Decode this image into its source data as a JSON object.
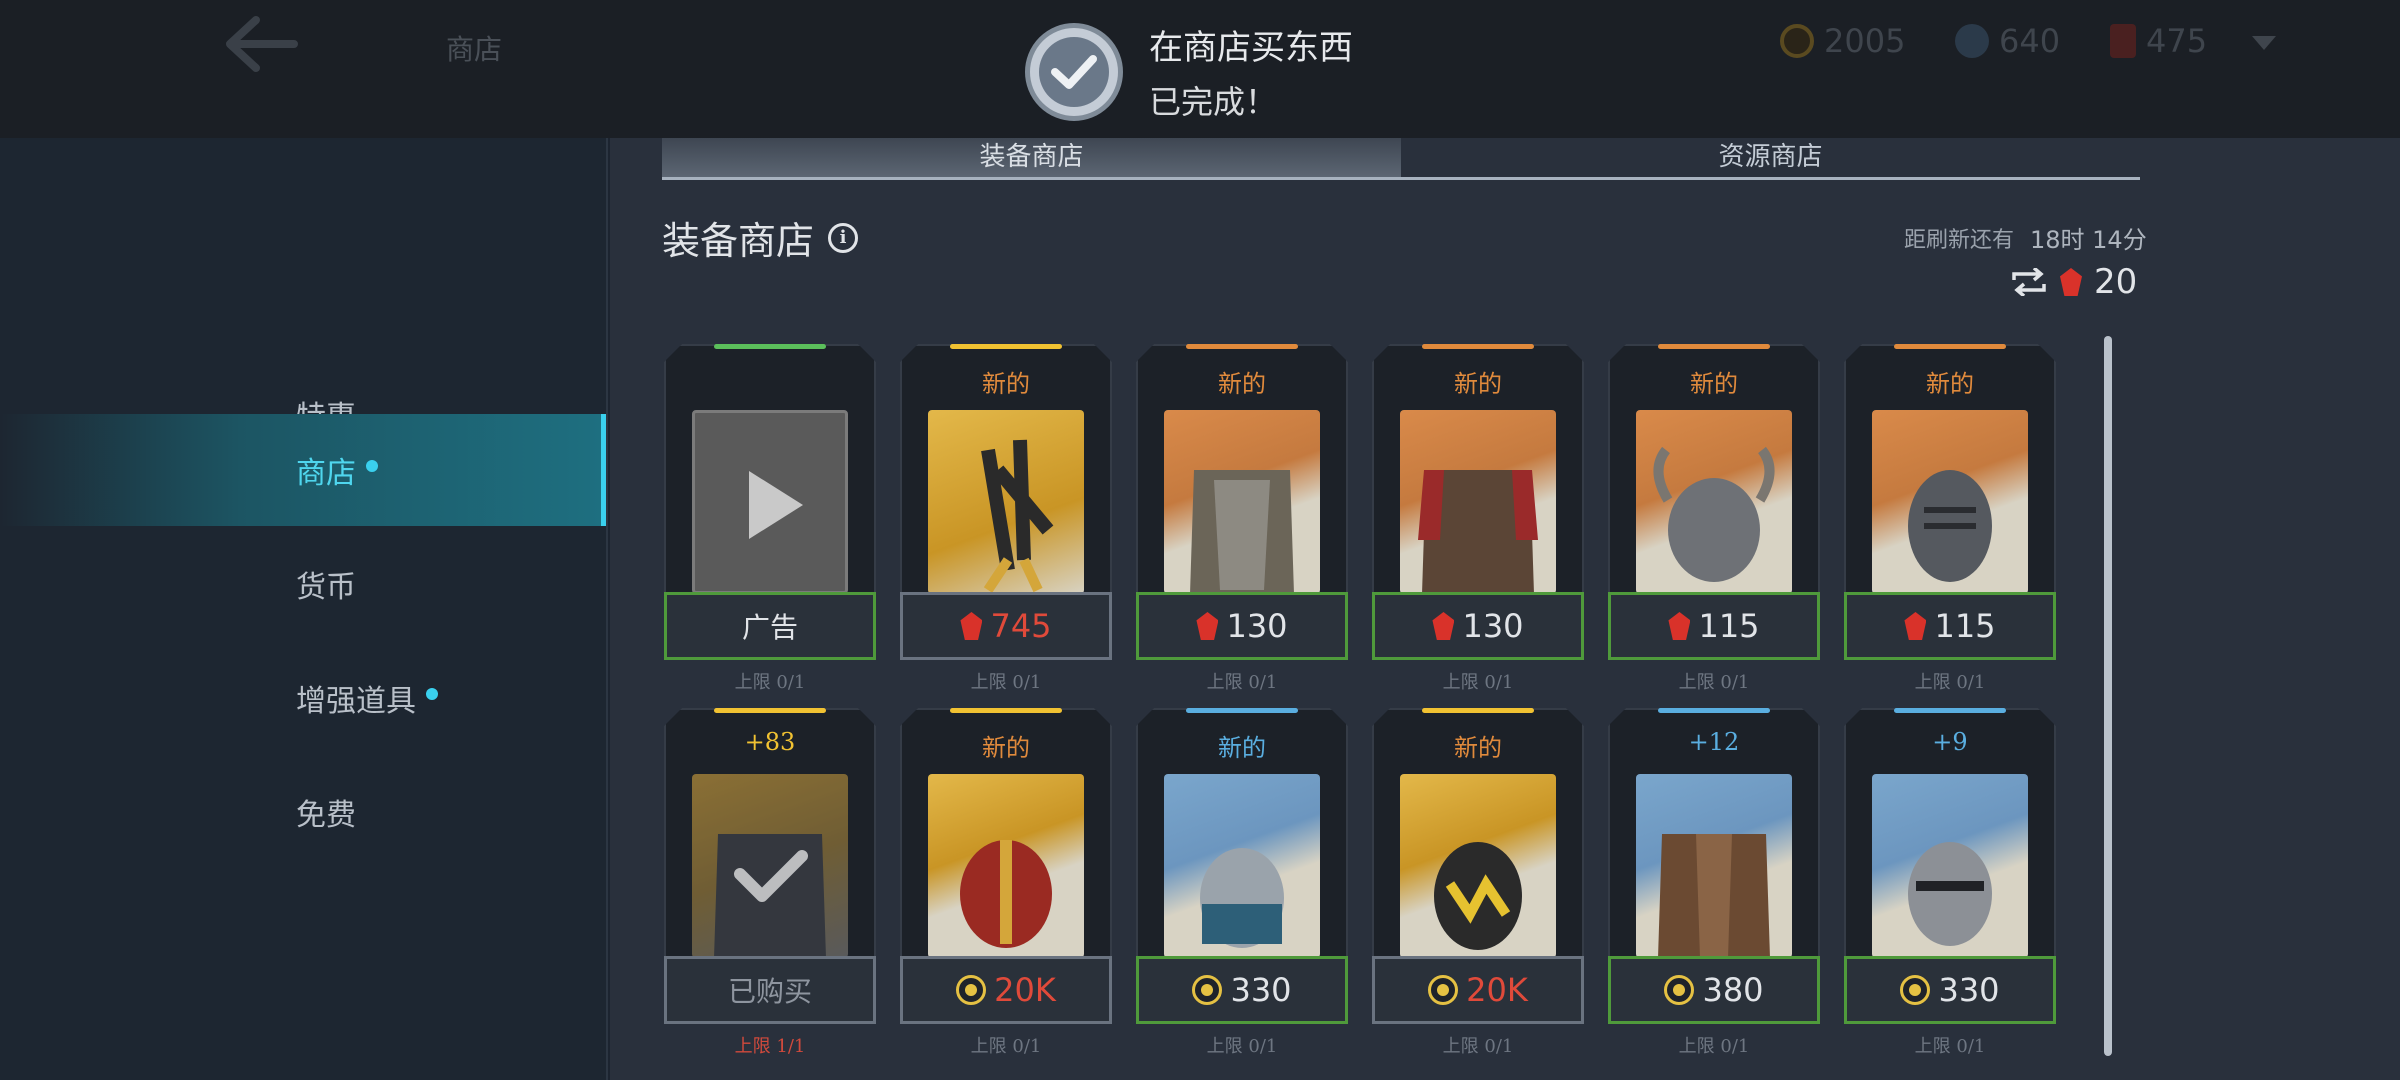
{
  "header": {
    "title": "商店",
    "currencies": {
      "gold": "2005",
      "orb": "640",
      "gems": "475"
    }
  },
  "notification": {
    "title": "在商店买东西",
    "subtitle": "已完成！"
  },
  "sidebar": {
    "items": [
      {
        "label": "特惠"
      },
      {
        "label": "商店"
      },
      {
        "label": "货币"
      },
      {
        "label": "增强道具"
      },
      {
        "label": "免费"
      }
    ]
  },
  "tabs": [
    {
      "label": "装备商店"
    },
    {
      "label": "资源商店"
    }
  ],
  "shop": {
    "title": "装备商店",
    "refresh_label": "距刷新还有",
    "refresh_time": "18时 14分",
    "refresh_cost": "20"
  },
  "items": [
    {
      "tag": "",
      "price": "广告",
      "limit": "上限 0/1"
    },
    {
      "tag": "新的",
      "price": "745",
      "limit": "上限 0/1"
    },
    {
      "tag": "新的",
      "price": "130",
      "limit": "上限 0/1"
    },
    {
      "tag": "新的",
      "price": "130",
      "limit": "上限 0/1"
    },
    {
      "tag": "新的",
      "price": "115",
      "limit": "上限 0/1"
    },
    {
      "tag": "新的",
      "price": "115",
      "limit": "上限 0/1"
    },
    {
      "tag": "+83",
      "price": "已购买",
      "limit": "上限 1/1"
    },
    {
      "tag": "新的",
      "price": "20K",
      "limit": "上限 0/1"
    },
    {
      "tag": "新的",
      "price": "330",
      "limit": "上限 0/1"
    },
    {
      "tag": "新的",
      "price": "20K",
      "limit": "上限 0/1"
    },
    {
      "tag": "+12",
      "price": "380",
      "limit": "上限 0/1"
    },
    {
      "tag": "+9",
      "price": "330",
      "limit": "上限 0/1"
    }
  ],
  "colors": {
    "accent": "#3ad0ee",
    "gem": "#d9322a",
    "gold": "#e5c143",
    "tag_orange": "#e08a3c",
    "tag_blue": "#5aaee0",
    "tag_yellow": "#f1c232"
  }
}
